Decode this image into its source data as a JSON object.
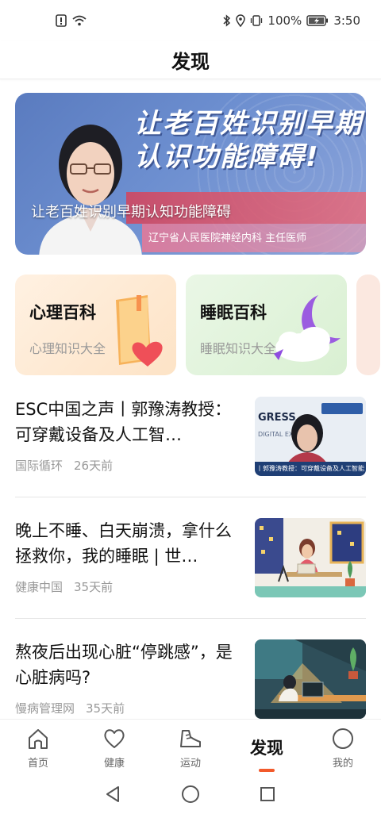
{
  "status_bar": {
    "battery": "100%",
    "time": "3:50"
  },
  "header": {
    "title": "发现"
  },
  "banner": {
    "headline_line1": "让老百姓识别早期",
    "headline_line2": "认识功能障碍!",
    "caption": "让老百姓识别早期认知功能障碍",
    "subtitle": "辽宁省人民医院神经内科 主任医师"
  },
  "categories": [
    {
      "title": "心理百科",
      "subtitle": "心理知识大全",
      "icon": "book-heart-icon"
    },
    {
      "title": "睡眠百科",
      "subtitle": "睡眠知识大全",
      "icon": "moon-cloud-icon"
    }
  ],
  "articles": [
    {
      "title": "ESC中国之声丨郭豫涛教授：可穿戴设备及人工智…",
      "source": "国际循环",
      "time": "26天前",
      "thumb_caption": "丨郭豫涛教授：可穿戴设备及人工智能"
    },
    {
      "title": "晚上不睡、白天崩溃，拿什么拯救你，我的睡眠 | 世…",
      "source": "健康中国",
      "time": "35天前"
    },
    {
      "title": "熬夜后出现心脏“停跳感”，是心脏病吗?",
      "source": "慢病管理网",
      "time": "35天前"
    }
  ],
  "bottom_nav": [
    {
      "label": "首页",
      "icon": "home-icon"
    },
    {
      "label": "健康",
      "icon": "heart-icon"
    },
    {
      "label": "运动",
      "icon": "shoe-icon"
    },
    {
      "label": "发现",
      "icon": "",
      "active": true
    },
    {
      "label": "我的",
      "icon": "profile-icon"
    }
  ],
  "colors": {
    "accent": "#f25a2b",
    "banner_blue": "#6d8fd0"
  }
}
